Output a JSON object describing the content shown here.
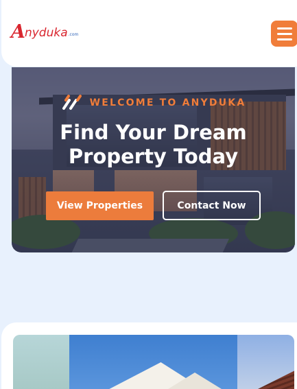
{
  "header": {
    "logo": {
      "first_letter": "A",
      "rest": "nyduka",
      "suffix": ".com"
    },
    "menu_icon": "hamburger-icon"
  },
  "hero": {
    "welcome_icon": "double-slash-icon",
    "welcome_text": "WELCOME TO ANYDUKA",
    "title": "Find Your Dream Property Today",
    "primary_button": "View Properties",
    "secondary_button": "Contact Now"
  },
  "colors": {
    "accent": "#f07d3a",
    "logo_red": "#d9262f",
    "page_bg": "#e8f1fd"
  }
}
